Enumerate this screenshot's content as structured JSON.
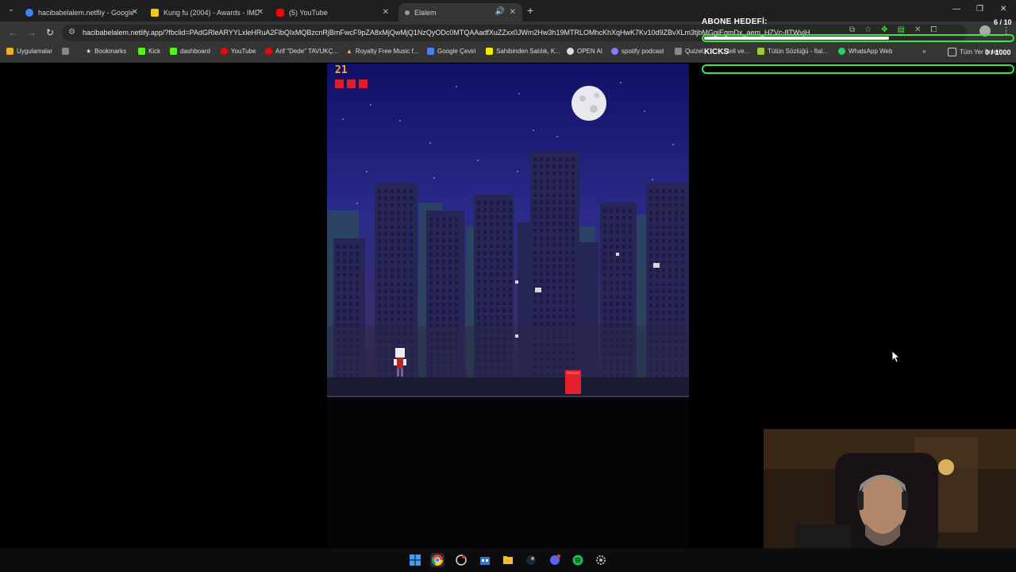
{
  "browser": {
    "tabs": [
      {
        "title": "hacibabelalem.netfliy - Google",
        "favicon_color": "#4285f4"
      },
      {
        "title": "Kung fu (2004) - Awards - IMDb",
        "favicon_color": "#f5c518"
      },
      {
        "title": "(5) YouTube",
        "favicon_color": "#ff0000"
      },
      {
        "title": "Elalem",
        "favicon_color": "#9a9a9a",
        "active": true
      }
    ],
    "url": "hacibabelalem.netlify.app/?fbclid=PAdGRleARYYLxleHRuA2FlbQIxMQBzcnRjBmFwcF9pZA8xMjQwMjQ1NzQyODc0MTQAAadfXuZZxx0JWm2Hw3h19MTRLOMhcKhXqHwK7Kv10d9ZBvXLm3tjbMGgiEgmDx_aem_HZVc-8TWvjH...",
    "bookmarks": [
      {
        "label": "Uygulamalar",
        "icon": "apps-grid-icon",
        "color": "#f0b030"
      },
      {
        "label": "",
        "icon": "grid-icon",
        "color": "#cccccc"
      },
      {
        "label": "Bookmarks",
        "icon": "star-icon",
        "color": "#cccccc"
      },
      {
        "label": "Kick",
        "icon": "kick-icon",
        "color": "#53fc18"
      },
      {
        "label": "dashboard",
        "icon": "kick-icon",
        "color": "#53fc18"
      },
      {
        "label": "YouTube",
        "icon": "youtube-icon",
        "color": "#ff0000"
      },
      {
        "label": "Arif \"Dede\" TAVUKÇ...",
        "icon": "youtube-icon",
        "color": "#ff0000"
      },
      {
        "label": "Royalty Free Music f...",
        "icon": "triangle-icon",
        "color": "#f0c030"
      },
      {
        "label": "Google Çeviri",
        "icon": "translate-icon",
        "color": "#4285f4"
      },
      {
        "label": "Sahibinden Satılık, K...",
        "icon": "s-icon",
        "color": "#ffe800"
      },
      {
        "label": "OPEN AI",
        "icon": "openai-icon",
        "color": "#dddddd"
      },
      {
        "label": "spotify podcast",
        "icon": "circle-icon",
        "color": "#7f7fff"
      },
      {
        "label": "Quizel...",
        "icon": "bookmark-icon",
        "color": "#cccccc"
      },
      {
        "label": "...teli ve...",
        "icon": "bookmark-icon",
        "color": "#cccccc"
      },
      {
        "label": "Tütün Sözlüğü - İtal...",
        "icon": "leaf-icon",
        "color": "#9acd32"
      },
      {
        "label": "WhatsApp Web",
        "icon": "whatsapp-icon",
        "color": "#25d366"
      },
      {
        "label": "Tüm Yer İmleri",
        "icon": "folder-icon",
        "color": "#cccccc"
      }
    ]
  },
  "game": {
    "score": "21",
    "lives": 3,
    "life_color": "#d8202c",
    "score_color": "#f0b030"
  },
  "overlay": {
    "sub_goal_label": "ABONE HEDEFİ:",
    "sub_goal_count": "6 / 10",
    "sub_goal_progress": 0.6,
    "kicks_label": "KICKS",
    "kicks_count": "0 / 1000",
    "kicks_progress": 0.0,
    "accent": "#3fe43f"
  },
  "taskbar": {
    "apps": [
      "windows-start-icon",
      "chrome-icon",
      "obs-icon",
      "store-icon",
      "file-explorer-icon",
      "steam-icon",
      "discord-icon",
      "spotify-icon",
      "settings-icon"
    ]
  }
}
